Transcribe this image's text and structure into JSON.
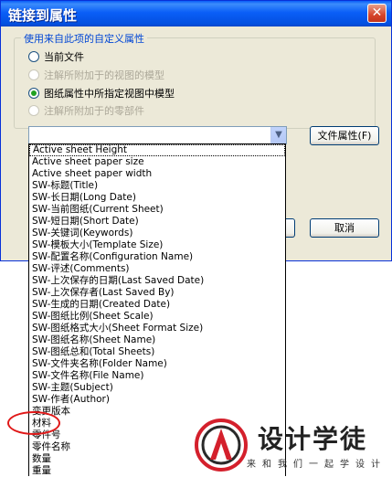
{
  "window": {
    "title": "链接到属性",
    "close_glyph": "✕"
  },
  "group": {
    "label": "使用来自此项的自定义属性",
    "options": [
      {
        "label": "当前文件",
        "checked": false,
        "enabled": true
      },
      {
        "label": "注解所附加于的视图的模型",
        "checked": false,
        "enabled": false
      },
      {
        "label": "图纸属性中所指定视图中模型",
        "checked": true,
        "enabled": true
      },
      {
        "label": "注解所附加于的零部件",
        "checked": false,
        "enabled": false
      }
    ]
  },
  "combo": {
    "value": "",
    "arrow_icon": "chevron-down-icon"
  },
  "buttons": {
    "file_props": "文件属性(F)",
    "cancel": "取消"
  },
  "dropdown_items": [
    "Active sheet Height",
    "Active sheet paper size",
    "Active sheet paper width",
    "SW-标题(Title)",
    "SW-长日期(Long Date)",
    "SW-当前图纸(Current Sheet)",
    "SW-短日期(Short Date)",
    "SW-关键词(Keywords)",
    "SW-模板大小(Template Size)",
    "SW-配置名称(Configuration Name)",
    "SW-评述(Comments)",
    "SW-上次保存的日期(Last Saved Date)",
    "SW-上次保存者(Last Saved By)",
    "SW-生成的日期(Created Date)",
    "SW-图纸比例(Sheet Scale)",
    "SW-图纸格式大小(Sheet Format Size)",
    "SW-图纸名称(Sheet Name)",
    "SW-图纸总和(Total Sheets)",
    "SW-文件夹名称(Folder Name)",
    "SW-文件名称(File Name)",
    "SW-主题(Subject)",
    "SW-作者(Author)",
    "变更版本",
    "材料",
    "零件号",
    "零件名称",
    "数量",
    "重量"
  ],
  "watermark": {
    "brand": "设计学徒",
    "tagline": "来和我们一起学设计",
    "accent": "#d4202c"
  }
}
